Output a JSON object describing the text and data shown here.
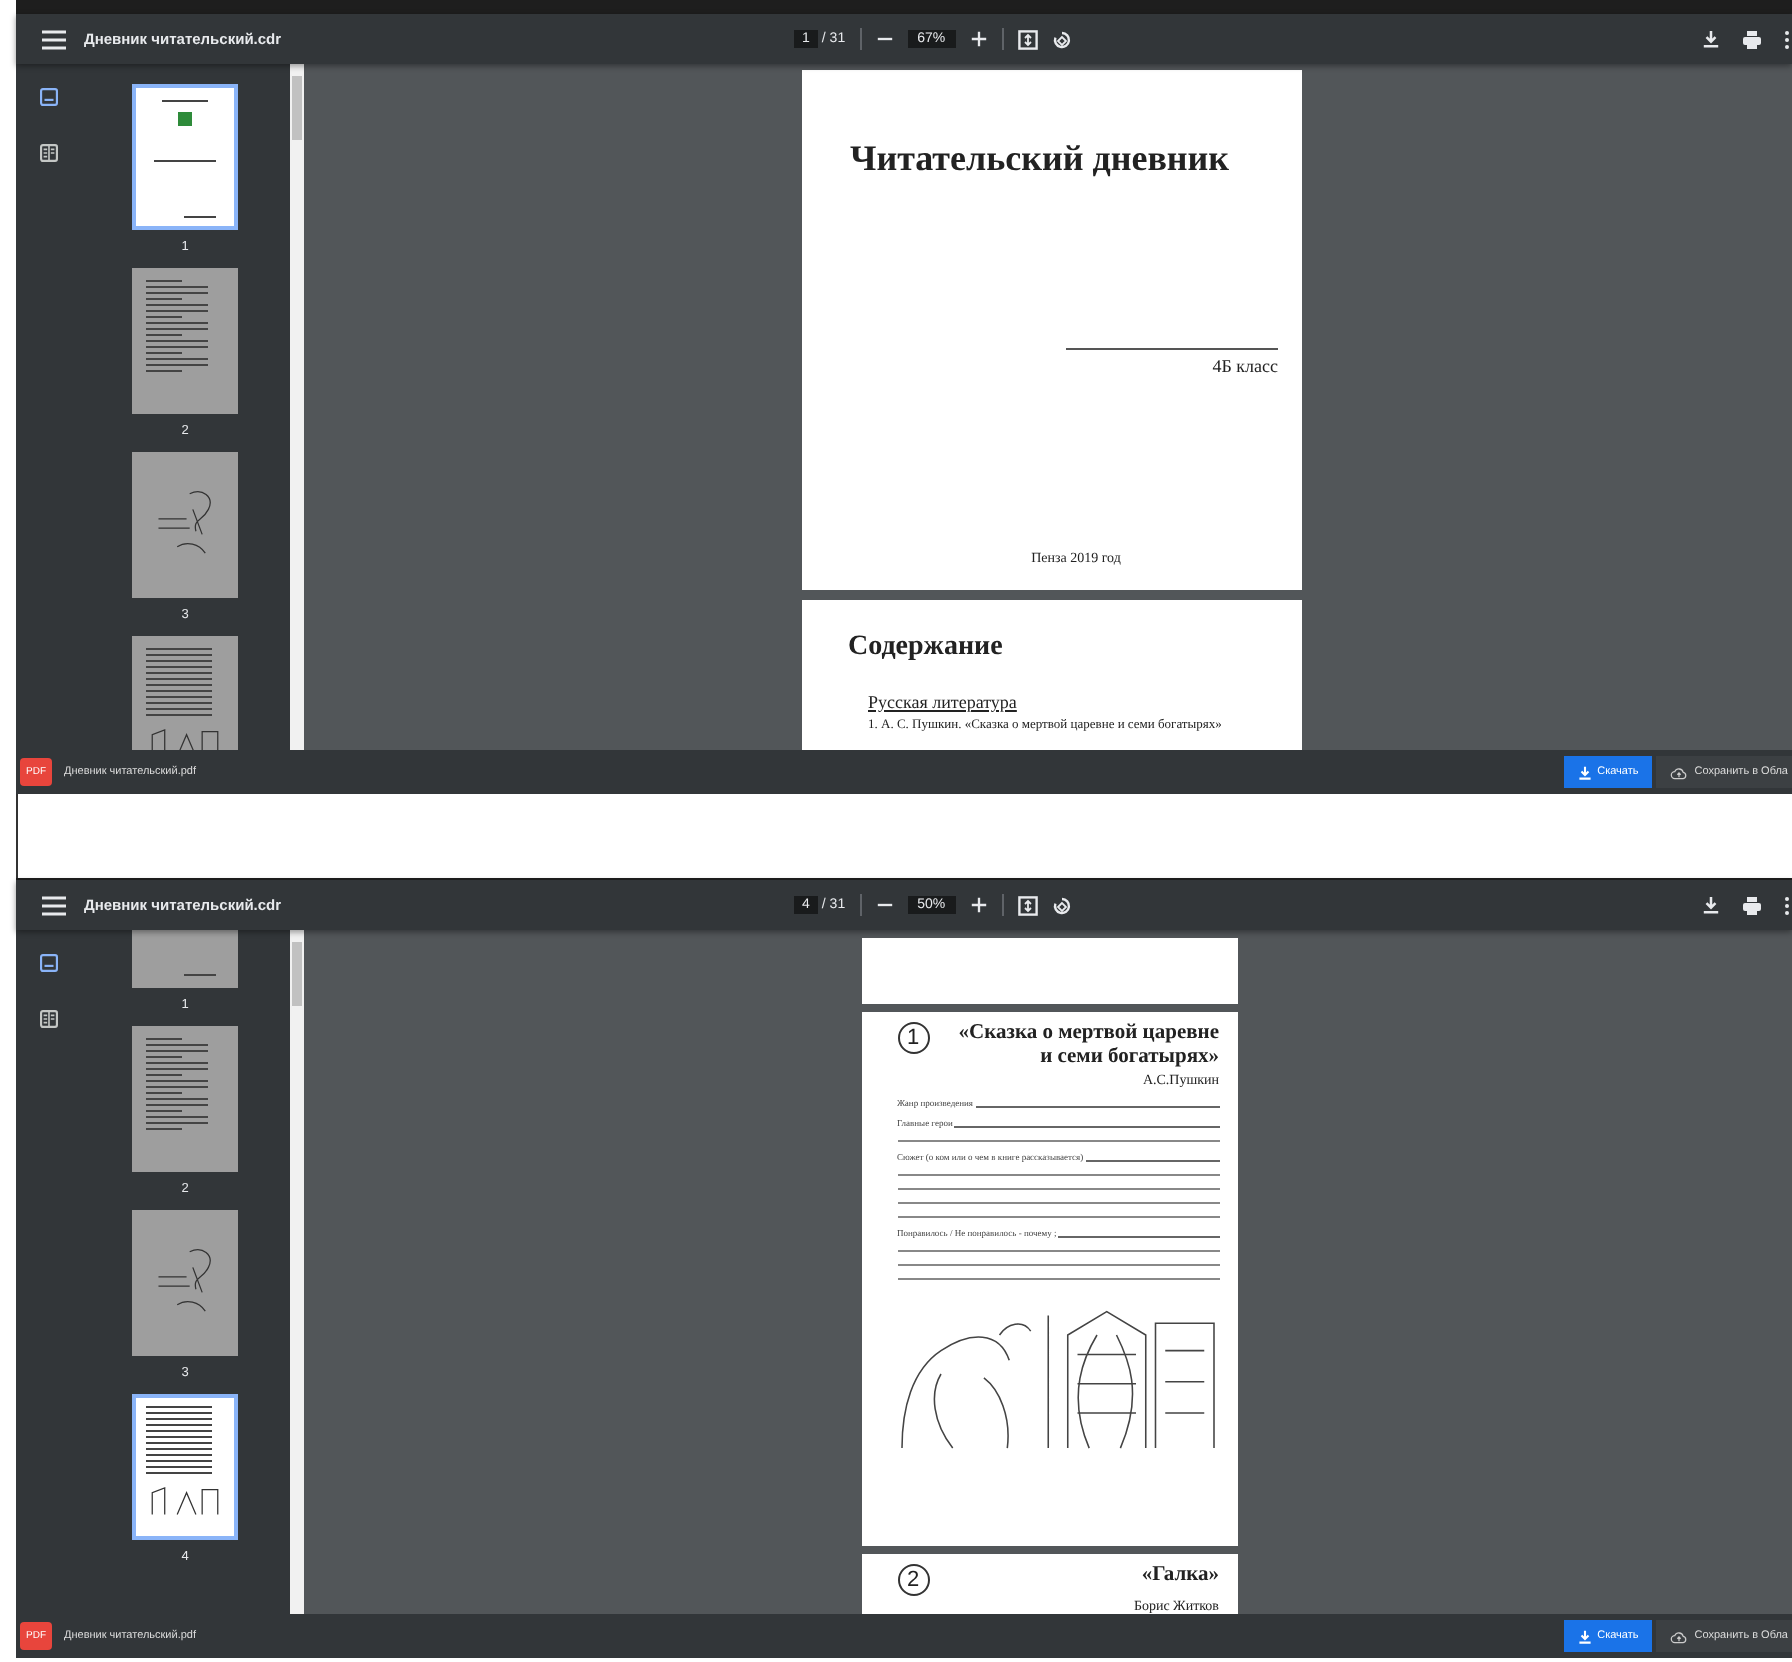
{
  "viewers": [
    {
      "title": "Дневник читательский.cdr",
      "page": "1",
      "total": "/ 31",
      "zoom": "67%",
      "sidebar_tabs": [
        {
          "kind": "thumbnails",
          "selected": true
        },
        {
          "kind": "outline",
          "selected": false
        }
      ],
      "thumbnails": [
        {
          "kind": "cover",
          "label": "1",
          "selected": true
        },
        {
          "kind": "contents",
          "label": "2",
          "selected": false
        },
        {
          "kind": "illustration",
          "label": "3",
          "selected": false
        },
        {
          "kind": "form",
          "selected": false
        }
      ],
      "pages": [
        {
          "kind": "cover",
          "title": "Читательский дневник",
          "class": "4Б класс",
          "footer": "Пенза 2019 год"
        },
        {
          "kind": "contents",
          "heading": "Содержание",
          "section": "Русская литература",
          "item": "1. А. С. Пушкин. «Сказка о мертвой царевне и семи богатырях»"
        }
      ],
      "footer": {
        "badge": "PDF",
        "file": "Дневник читательский.pdf",
        "download": "Скачать",
        "save": "Сохранить в Обла"
      }
    },
    {
      "title": "Дневник читательский.cdr",
      "page": "4",
      "total": "/ 31",
      "zoom": "50%",
      "sidebar_tabs": [
        {
          "kind": "thumbnails",
          "selected": true
        },
        {
          "kind": "outline",
          "selected": false
        }
      ],
      "thumbnails": [
        {
          "kind": "cover",
          "label": "1",
          "selected": false
        },
        {
          "kind": "contents",
          "label": "2",
          "selected": false
        },
        {
          "kind": "illustration",
          "label": "3",
          "selected": false
        },
        {
          "kind": "form",
          "label": "4",
          "selected": true
        }
      ],
      "pages": [
        {
          "kind": "blank"
        },
        {
          "kind": "form",
          "number": "1",
          "title": "«Сказка о мертвой царевне и семи богатырях»",
          "author": "А.С.Пушкин",
          "fields": [
            {
              "label": "Жанр произведения"
            },
            {
              "label": "Главные герои"
            },
            {
              "label": "Сюжет (о ком или о чем в книге рассказывается)"
            },
            {
              "label": "Понравилось / Не понравилось - почему ;"
            }
          ]
        },
        {
          "kind": "heading",
          "number": "2",
          "title": "«Галка»",
          "author": "Борис Житков"
        }
      ],
      "footer": {
        "badge": "PDF",
        "file": "Дневник читательский.pdf",
        "download": "Скачать",
        "save": "Сохранить в Обла"
      }
    }
  ]
}
